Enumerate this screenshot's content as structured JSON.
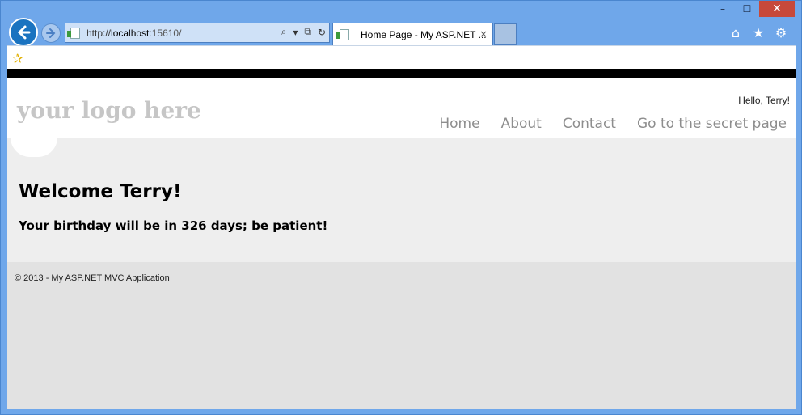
{
  "browser": {
    "url_prefix": "http://",
    "url_host": "localhost",
    "url_port": ":15610/",
    "tab_title": "Home Page - My ASP.NET ...",
    "tab_close": "×",
    "controls": {
      "minimize": "–",
      "maximize": "☐",
      "close": "✕"
    },
    "tools": {
      "search": "⌕",
      "dropdown": "▾",
      "compat": "⧉",
      "refresh": "↻"
    },
    "right_icons": {
      "home": "⌂",
      "favorites": "★",
      "settings": "⚙"
    },
    "favorites_icon": "✰"
  },
  "site": {
    "logo": "your logo here",
    "greeting": "Hello, Terry!",
    "menu": [
      "Home",
      "About",
      "Contact",
      "Go to the secret page"
    ]
  },
  "content": {
    "heading": "Welcome Terry!",
    "message": "Your birthday will be in 326 days; be patient!"
  },
  "footer": {
    "text": "© 2013 - My ASP.NET MVC Application"
  },
  "colors": {
    "window_accent": "#6fa7ea",
    "close_button": "#c7493a",
    "back_button": "#1a73c0"
  }
}
